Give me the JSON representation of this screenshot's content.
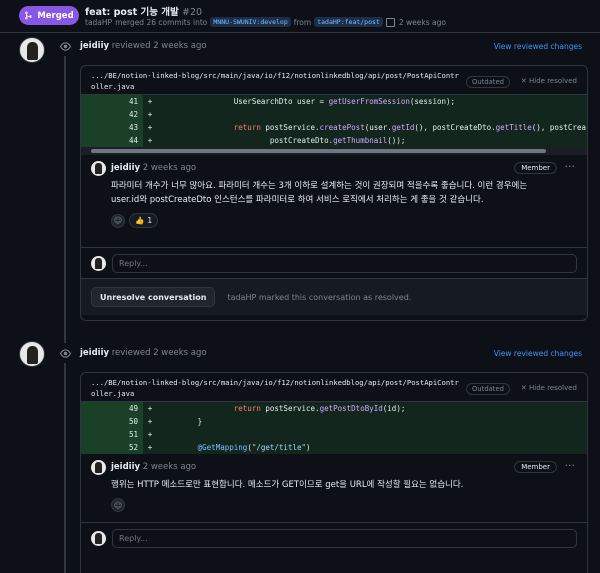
{
  "header": {
    "badge": "Merged",
    "title": "feat: post 기능 개발",
    "pr_number": "#20",
    "author": "tadaHP",
    "merged_text": "merged 26 commits into",
    "base_branch": "MNNU-SWUNIV:develop",
    "from_text": "from",
    "head_branch": "tadaHP:feat/post",
    "time": "2 weeks ago"
  },
  "reviews": [
    {
      "reviewer": "jeidiiy",
      "action": "reviewed 2 weeks ago",
      "view_link": "View reviewed changes",
      "file_path": ".../BE/notion-linked-blog/src/main/java/io/f12/notionlinkedblog/api/post/PostApiController.java",
      "outdated": "Outdated",
      "hide_resolved": "Hide resolved",
      "code_lines": [
        {
          "num": "41",
          "code": "UserSearchDto user = getUserFromSession(session);"
        },
        {
          "num": "42",
          "code": ""
        },
        {
          "num": "43",
          "code": "return postService.createPost(user.getId(), postCreateDto.getTitle(), postCrea"
        },
        {
          "num": "44",
          "code": "postCreateDto.getThumbnail());"
        }
      ],
      "comment": {
        "author": "jeidiiy",
        "time": "2 weeks ago",
        "role": "Member",
        "body_line1": "파라미터 개수가 너무 많아요. 파라미터 개수는 3개 이하로 설계하는 것이 권장되며 적을수록 좋습니다. 이런 경우에는",
        "body_line2": "user.id와 postCreateDto 인스턴스를 파라미터로 하여 서비스 로직에서 처리하는 게 좋을 것 같습니다.",
        "reaction_emoji": "👍",
        "reaction_count": "1"
      },
      "reply_placeholder": "Reply...",
      "unresolve_label": "Unresolve conversation",
      "resolved_by": "tadaHP",
      "resolved_text": "marked this conversation as resolved."
    },
    {
      "reviewer": "jeidiiy",
      "action": "reviewed 2 weeks ago",
      "view_link": "View reviewed changes",
      "file_path": ".../BE/notion-linked-blog/src/main/java/io/f12/notionlinkedblog/api/post/PostApiController.java",
      "outdated": "Outdated",
      "hide_resolved": "Hide resolved",
      "code_lines": [
        {
          "num": "49",
          "code": "return postService.getPostDtoById(id);"
        },
        {
          "num": "50",
          "code": "}"
        },
        {
          "num": "51",
          "code": ""
        },
        {
          "num": "52",
          "code": "@GetMapping(\"/get/title\")"
        }
      ],
      "comment": {
        "author": "jeidiiy",
        "time": "2 weeks ago",
        "role": "Member",
        "body_line1": "행위는 HTTP 메소드로만 표현합니다. 메소드가 GET이므로 get을 URL에 작성할 필요는 없습니다."
      },
      "reply_placeholder": "Reply..."
    }
  ],
  "colors": {
    "merged": "#8957e5",
    "link": "#4493f8",
    "added_bg": "#12261e",
    "background": "#0d1117"
  }
}
